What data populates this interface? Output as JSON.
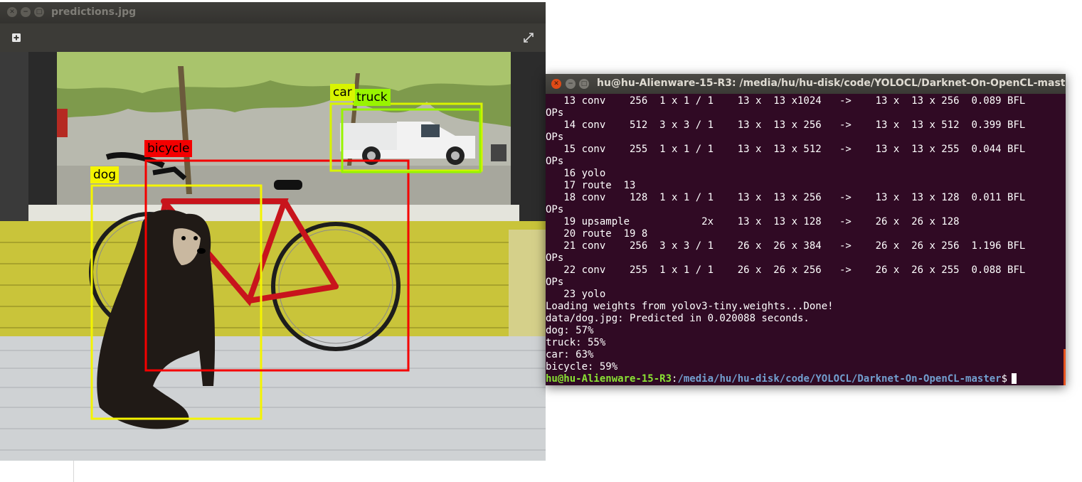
{
  "viewer": {
    "title": "predictions.jpg",
    "toolbar": {
      "add_icon": "plus-box-icon",
      "fullscreen_icon": "fullscreen-icon"
    },
    "detections": [
      {
        "label": "dog",
        "color": "#f4f400"
      },
      {
        "label": "bicycle",
        "color": "#f40000"
      },
      {
        "label": "car",
        "color": "#d8f400"
      },
      {
        "label": "truck",
        "color": "#98f400"
      }
    ]
  },
  "terminal": {
    "title": "hu@hu-Alienware-15-R3: /media/hu/hu-disk/code/YOLOCL/Darknet-On-OpenCL-master",
    "lines": [
      "   13 conv    256  1 x 1 / 1    13 x  13 x1024   ->    13 x  13 x 256  0.089 BFL",
      "OPs",
      "   14 conv    512  3 x 3 / 1    13 x  13 x 256   ->    13 x  13 x 512  0.399 BFL",
      "OPs",
      "   15 conv    255  1 x 1 / 1    13 x  13 x 512   ->    13 x  13 x 255  0.044 BFL",
      "OPs",
      "   16 yolo",
      "   17 route  13",
      "   18 conv    128  1 x 1 / 1    13 x  13 x 256   ->    13 x  13 x 128  0.011 BFL",
      "OPs",
      "   19 upsample            2x    13 x  13 x 128   ->    26 x  26 x 128",
      "   20 route  19 8",
      "   21 conv    256  3 x 3 / 1    26 x  26 x 384   ->    26 x  26 x 256  1.196 BFL",
      "OPs",
      "   22 conv    255  1 x 1 / 1    26 x  26 x 256   ->    26 x  26 x 255  0.088 BFL",
      "OPs",
      "   23 yolo",
      "Loading weights from yolov3-tiny.weights...Done!",
      "data/dog.jpg: Predicted in 0.020088 seconds.",
      "dog: 57%",
      "truck: 55%",
      "car: 63%",
      "bicycle: 59%"
    ],
    "prompt": {
      "user_host": "hu@hu-Alienware-15-R3",
      "separator": ":",
      "path": "/media/hu/hu-disk/code/YOLOCL/Darknet-On-OpenCL-master",
      "symbol": "$"
    },
    "colors": {
      "background": "#300a24",
      "user_host": "#8ae234",
      "path": "#729fcf",
      "text": "#ffffff"
    }
  }
}
